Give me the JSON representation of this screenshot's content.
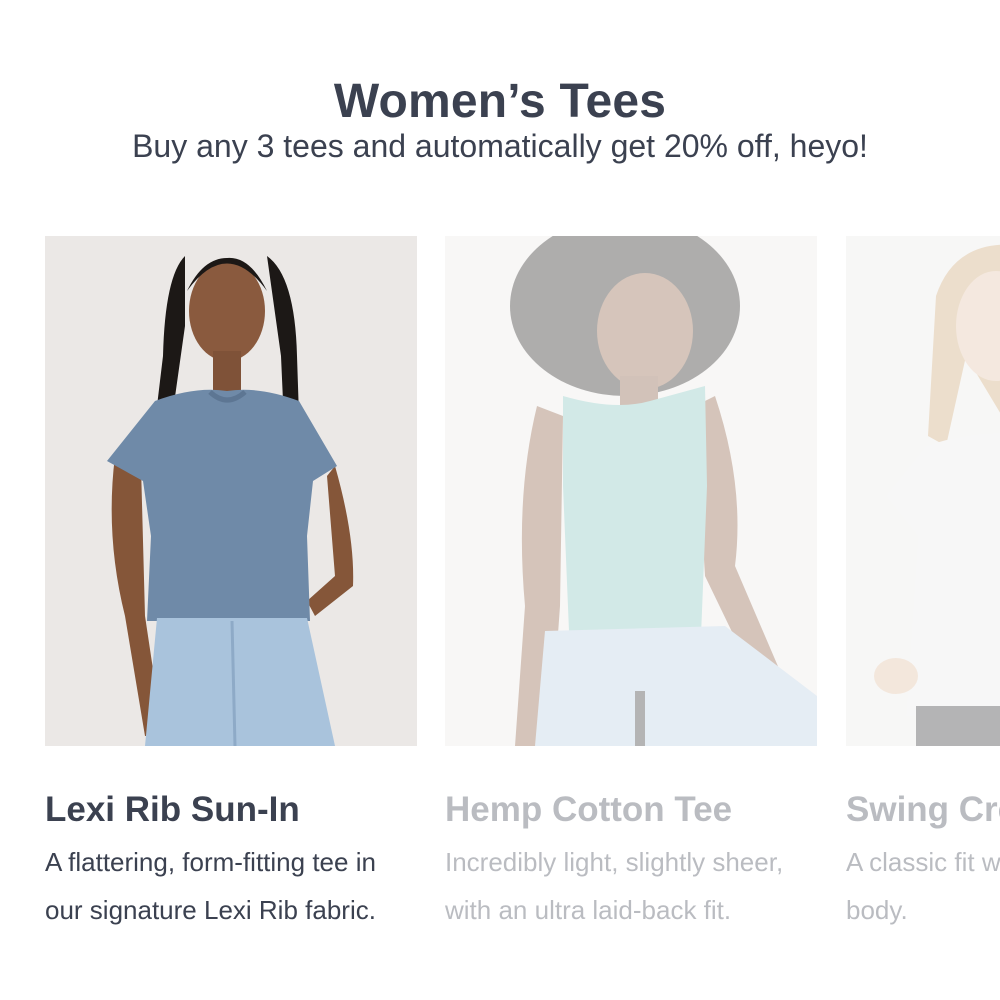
{
  "header": {
    "title": "Women’s Tees",
    "subtitle": "Buy any 3 tees and automatically get 20% off, heyo!"
  },
  "products": [
    {
      "name": "Lexi Rib Sun-In",
      "description": "A flattering, form-fitting tee in our signature Lexi Rib fabric.",
      "tee_color": "#6f8aa8",
      "active": true
    },
    {
      "name": "Hemp Cotton Tee",
      "description": "Incredibly light, slightly sheer, with an ultra laid-back fit.",
      "tee_color": "#7fc3bb",
      "active": false
    },
    {
      "name": "Swing Crew",
      "description": "A classic fit with a relaxed body.",
      "tee_color": "#e9e9e9",
      "active": false
    }
  ]
}
